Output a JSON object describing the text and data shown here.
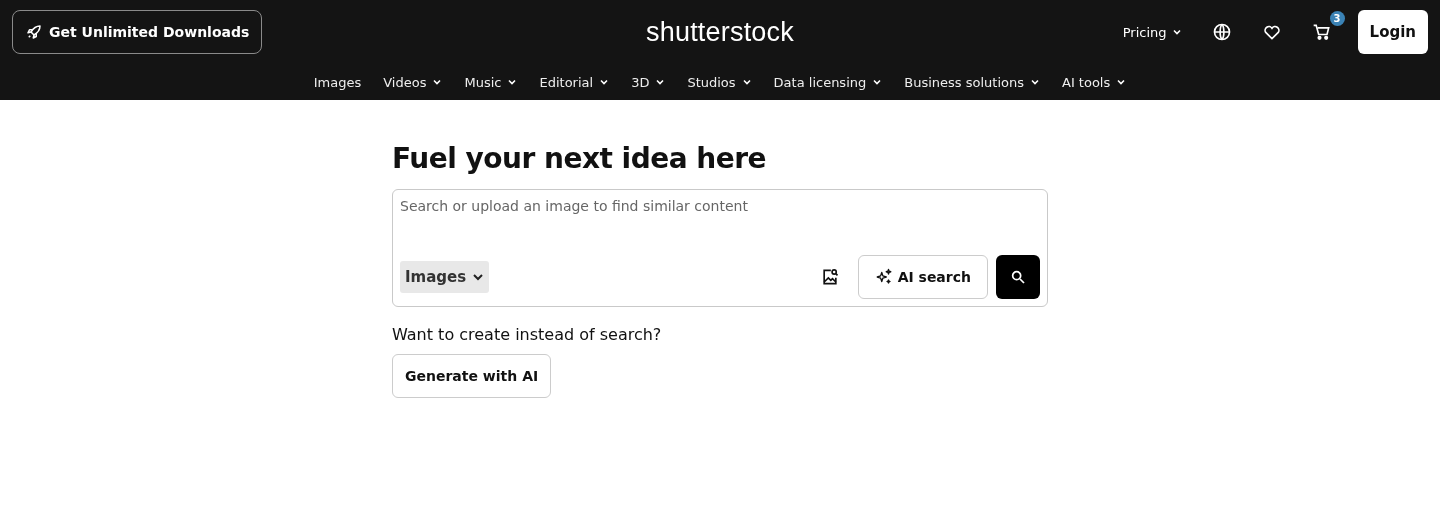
{
  "header": {
    "promo_button": "Get Unlimited Downloads",
    "logo": "shutterstock",
    "pricing": {
      "label": "Pricing",
      "has_menu": true
    },
    "cart_count": "3",
    "login_button": "Login"
  },
  "nav": [
    {
      "label": "Images",
      "has_menu": false
    },
    {
      "label": "Videos",
      "has_menu": true
    },
    {
      "label": "Music",
      "has_menu": true
    },
    {
      "label": "Editorial",
      "has_menu": true
    },
    {
      "label": "3D",
      "has_menu": true
    },
    {
      "label": "Studios",
      "has_menu": true
    },
    {
      "label": "Data licensing",
      "has_menu": true
    },
    {
      "label": "Business solutions",
      "has_menu": true
    },
    {
      "label": "AI tools",
      "has_menu": true
    }
  ],
  "hero": {
    "title": "Fuel your next idea here",
    "search": {
      "placeholder": "Search or upload an image to find similar content",
      "type_select": "Images",
      "ai_button": "AI search"
    },
    "create_prompt": "Want to create instead of search?",
    "generate_button": "Generate with AI"
  }
}
